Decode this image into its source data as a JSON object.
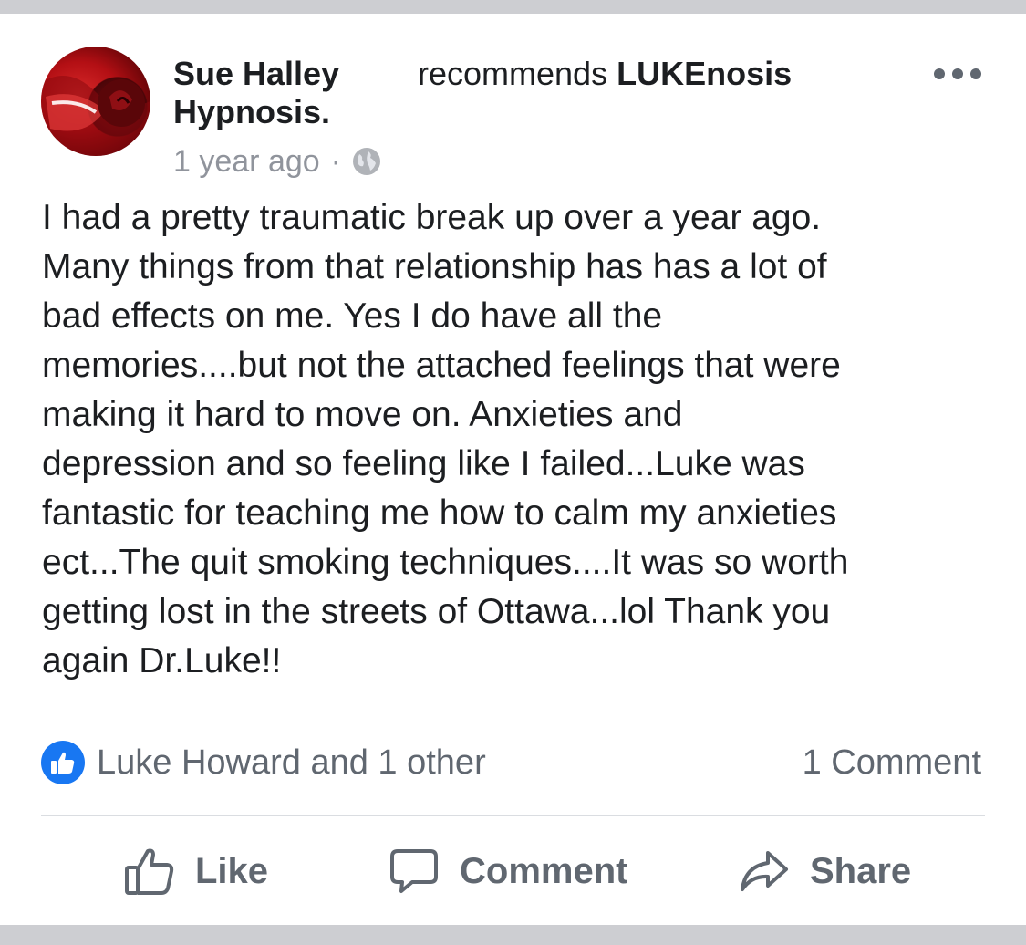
{
  "post": {
    "author": "Sue Halley Hypnosis.",
    "action_word": "recommends",
    "page_name": "LUKEnosis",
    "timestamp": "1 year ago",
    "separator": "·",
    "privacy_icon": "globe-icon",
    "more_icon": "ellipsis-icon",
    "text_lines": [
      "I had a pretty traumatic break up over a year ago.",
      "Many things from that relationship has has a lot of",
      "bad effects on me. Yes I do have all the",
      "memories....but not the attached feelings that were",
      "making it hard to move on. Anxieties and",
      "depression and so feeling like I failed...Luke was",
      "fantastic for teaching me how to calm my anxieties",
      "ect...The quit smoking techniques....It was so worth",
      "getting lost in the streets of Ottawa...lol Thank you",
      "again Dr.Luke!!"
    ]
  },
  "reactions": {
    "icon": "thumbs-up-icon",
    "reactors": "Luke Howard and 1 other",
    "comment_count": "1 Comment"
  },
  "actions": {
    "like": "Like",
    "comment": "Comment",
    "share": "Share"
  },
  "colors": {
    "brand_blue": "#1877f2",
    "secondary_text": "#606770",
    "meta_text": "#90949c",
    "frame_gray": "#cdced2"
  }
}
